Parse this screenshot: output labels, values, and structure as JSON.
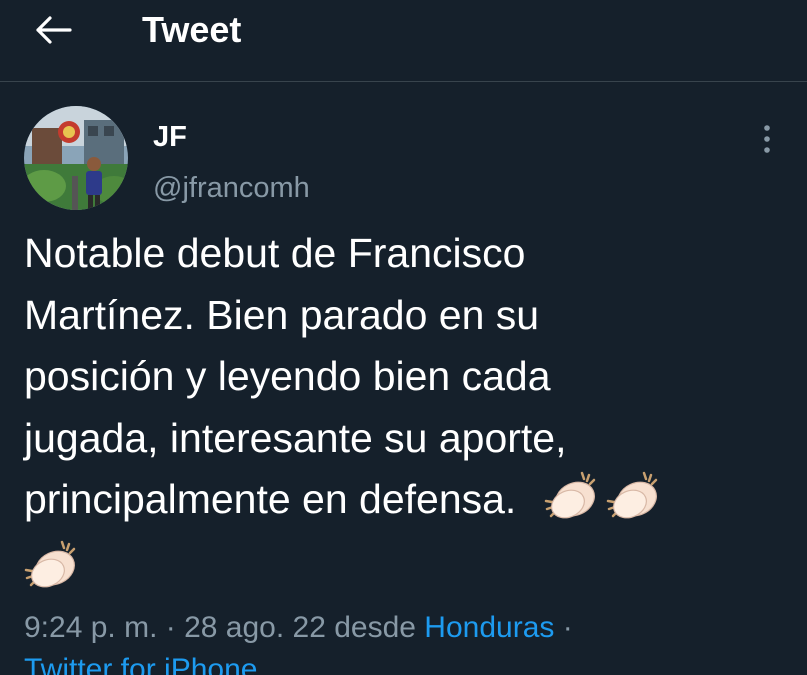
{
  "header": {
    "back_icon": "arrow-left-icon",
    "title": "Tweet"
  },
  "tweet": {
    "author": {
      "name": "JF",
      "handle": "@jfrancomh",
      "avatar_icon": "avatar-photo"
    },
    "more_icon": "vertical-ellipsis-icon",
    "text_lines": [
      "Notable debut de Francisco",
      "Martínez. Bien parado en su",
      "posición y leyendo bien cada",
      "jugada, interesante su aporte,",
      "principalmente en defensa."
    ],
    "emojis": [
      "clapping-hands-icon",
      "clapping-hands-icon",
      "clapping-hands-icon"
    ],
    "time": "9:24 p. m.",
    "sep1": " · ",
    "date": "28 ago. 22",
    "from_label": " desde ",
    "location": "Honduras",
    "sep2": " ·",
    "source": "Twitter for iPhone"
  },
  "colors": {
    "background": "#15202b",
    "text": "#ffffff",
    "secondary": "#8899a6",
    "link": "#1d9bf0",
    "divider": "#38444d"
  }
}
